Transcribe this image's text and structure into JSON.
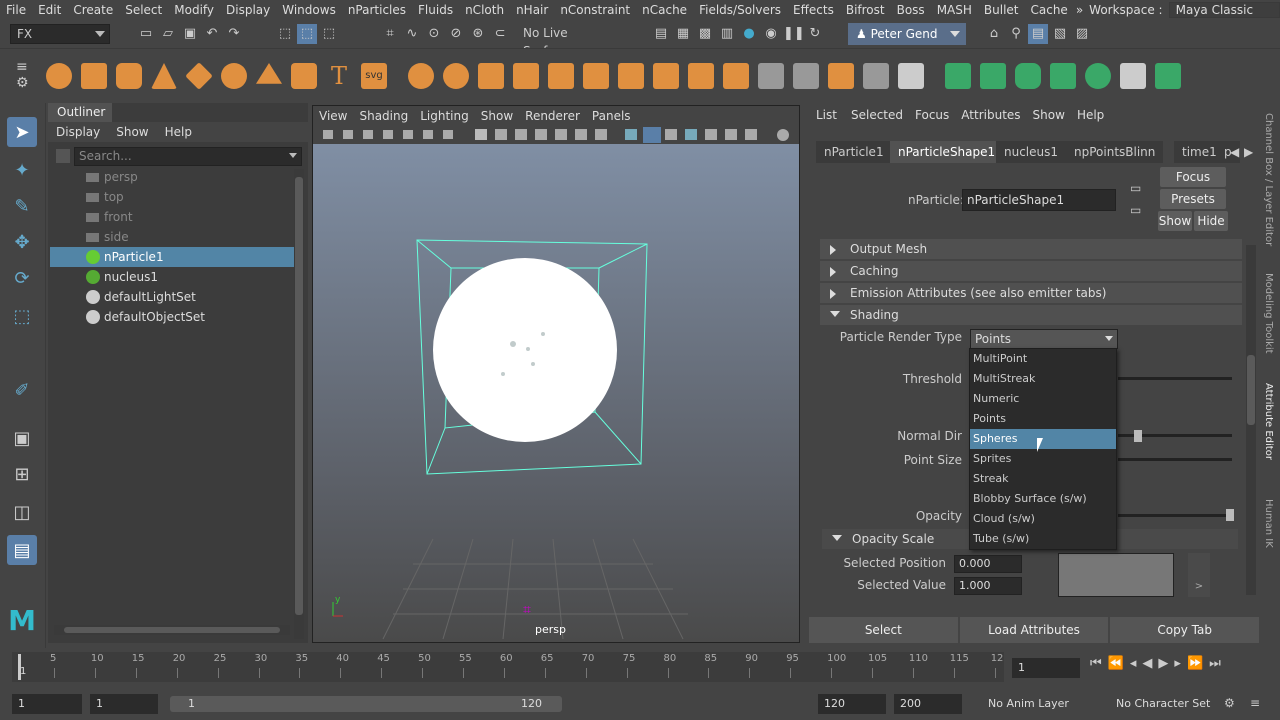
{
  "menubar": {
    "items": [
      "File",
      "Edit",
      "Create",
      "Select",
      "Modify",
      "Display",
      "Windows",
      "nParticles",
      "Fluids",
      "nCloth",
      "nHair",
      "nConstraint",
      "nCache",
      "Fields/Solvers",
      "Effects",
      "Bifrost",
      "Boss",
      "MASH",
      "Bullet",
      "Cache"
    ],
    "more": "»",
    "workspace_label": "Workspace :",
    "workspace_value": "Maya Classic"
  },
  "statusline": {
    "menu_set": "FX",
    "live_surface": "No Live Surface",
    "user": "Peter Gend"
  },
  "outliner": {
    "title": "Outliner",
    "menu": [
      "Display",
      "Show",
      "Help"
    ],
    "search_placeholder": "Search...",
    "items": [
      {
        "label": "persp",
        "icon": "camera-icon"
      },
      {
        "label": "top",
        "icon": "camera-icon"
      },
      {
        "label": "front",
        "icon": "camera-icon"
      },
      {
        "label": "side",
        "icon": "camera-icon"
      },
      {
        "label": "nParticle1",
        "icon": "nparticle-icon"
      },
      {
        "label": "nucleus1",
        "icon": "nucleus-icon"
      },
      {
        "label": "defaultLightSet",
        "icon": "set-icon"
      },
      {
        "label": "defaultObjectSet",
        "icon": "set-icon"
      }
    ]
  },
  "viewport": {
    "menu": [
      "View",
      "Shading",
      "Lighting",
      "Show",
      "Renderer",
      "Panels"
    ],
    "camera_label": "persp"
  },
  "attribute_editor": {
    "menu": [
      "List",
      "Selected",
      "Focus",
      "Attributes",
      "Show",
      "Help"
    ],
    "tabs": [
      "nParticle1",
      "nParticleShape1",
      "nucleus1",
      "npPointsBlinn",
      "time1",
      "p"
    ],
    "node_label": "nParticle:",
    "node_value": "nParticleShape1",
    "focus_btn": "Focus",
    "presets_btn": "Presets",
    "show_btn": "Show",
    "hide_btn": "Hide",
    "sections": {
      "output_mesh": "Output Mesh",
      "caching": "Caching",
      "emission": "Emission Attributes (see also emitter tabs)",
      "shading": "Shading",
      "opacity_scale": "Opacity Scale"
    },
    "render_type_label": "Particle Render Type",
    "render_type_value": "Points",
    "threshold_label": "Threshold",
    "normal_dir_label": "Normal Dir",
    "point_size_label": "Point Size",
    "opacity_label": "Opacity",
    "selected_position_label": "Selected Position",
    "selected_position_value": "0.000",
    "selected_value_label": "Selected Value",
    "selected_value_value": "1.000",
    "select_btn": "Select",
    "load_btn": "Load Attributes",
    "copy_btn": "Copy Tab"
  },
  "dropdown": {
    "options": [
      "MultiPoint",
      "MultiStreak",
      "Numeric",
      "Points",
      "Spheres",
      "Sprites",
      "Streak",
      "Blobby Surface (s/w)",
      "Cloud (s/w)",
      "Tube (s/w)"
    ],
    "highlighted": "Spheres"
  },
  "timeline": {
    "ticks": [
      "5",
      "10",
      "15",
      "20",
      "25",
      "30",
      "35",
      "40",
      "45",
      "50",
      "55",
      "60",
      "65",
      "70",
      "75",
      "80",
      "85",
      "90",
      "95",
      "100",
      "105",
      "110",
      "115",
      "12"
    ],
    "current_frame": "1",
    "start_marker": "1"
  },
  "range": {
    "start": "1",
    "playback_start": "1",
    "range_start": "1",
    "range_end": "120",
    "playback_end": "120",
    "end": "200",
    "anim_layer": "No Anim Layer",
    "character_set": "No Character Set"
  },
  "sidetabs": [
    "Channel Box / Layer Editor",
    "Modeling Toolkit",
    "Attribute Editor",
    "Human IK"
  ]
}
